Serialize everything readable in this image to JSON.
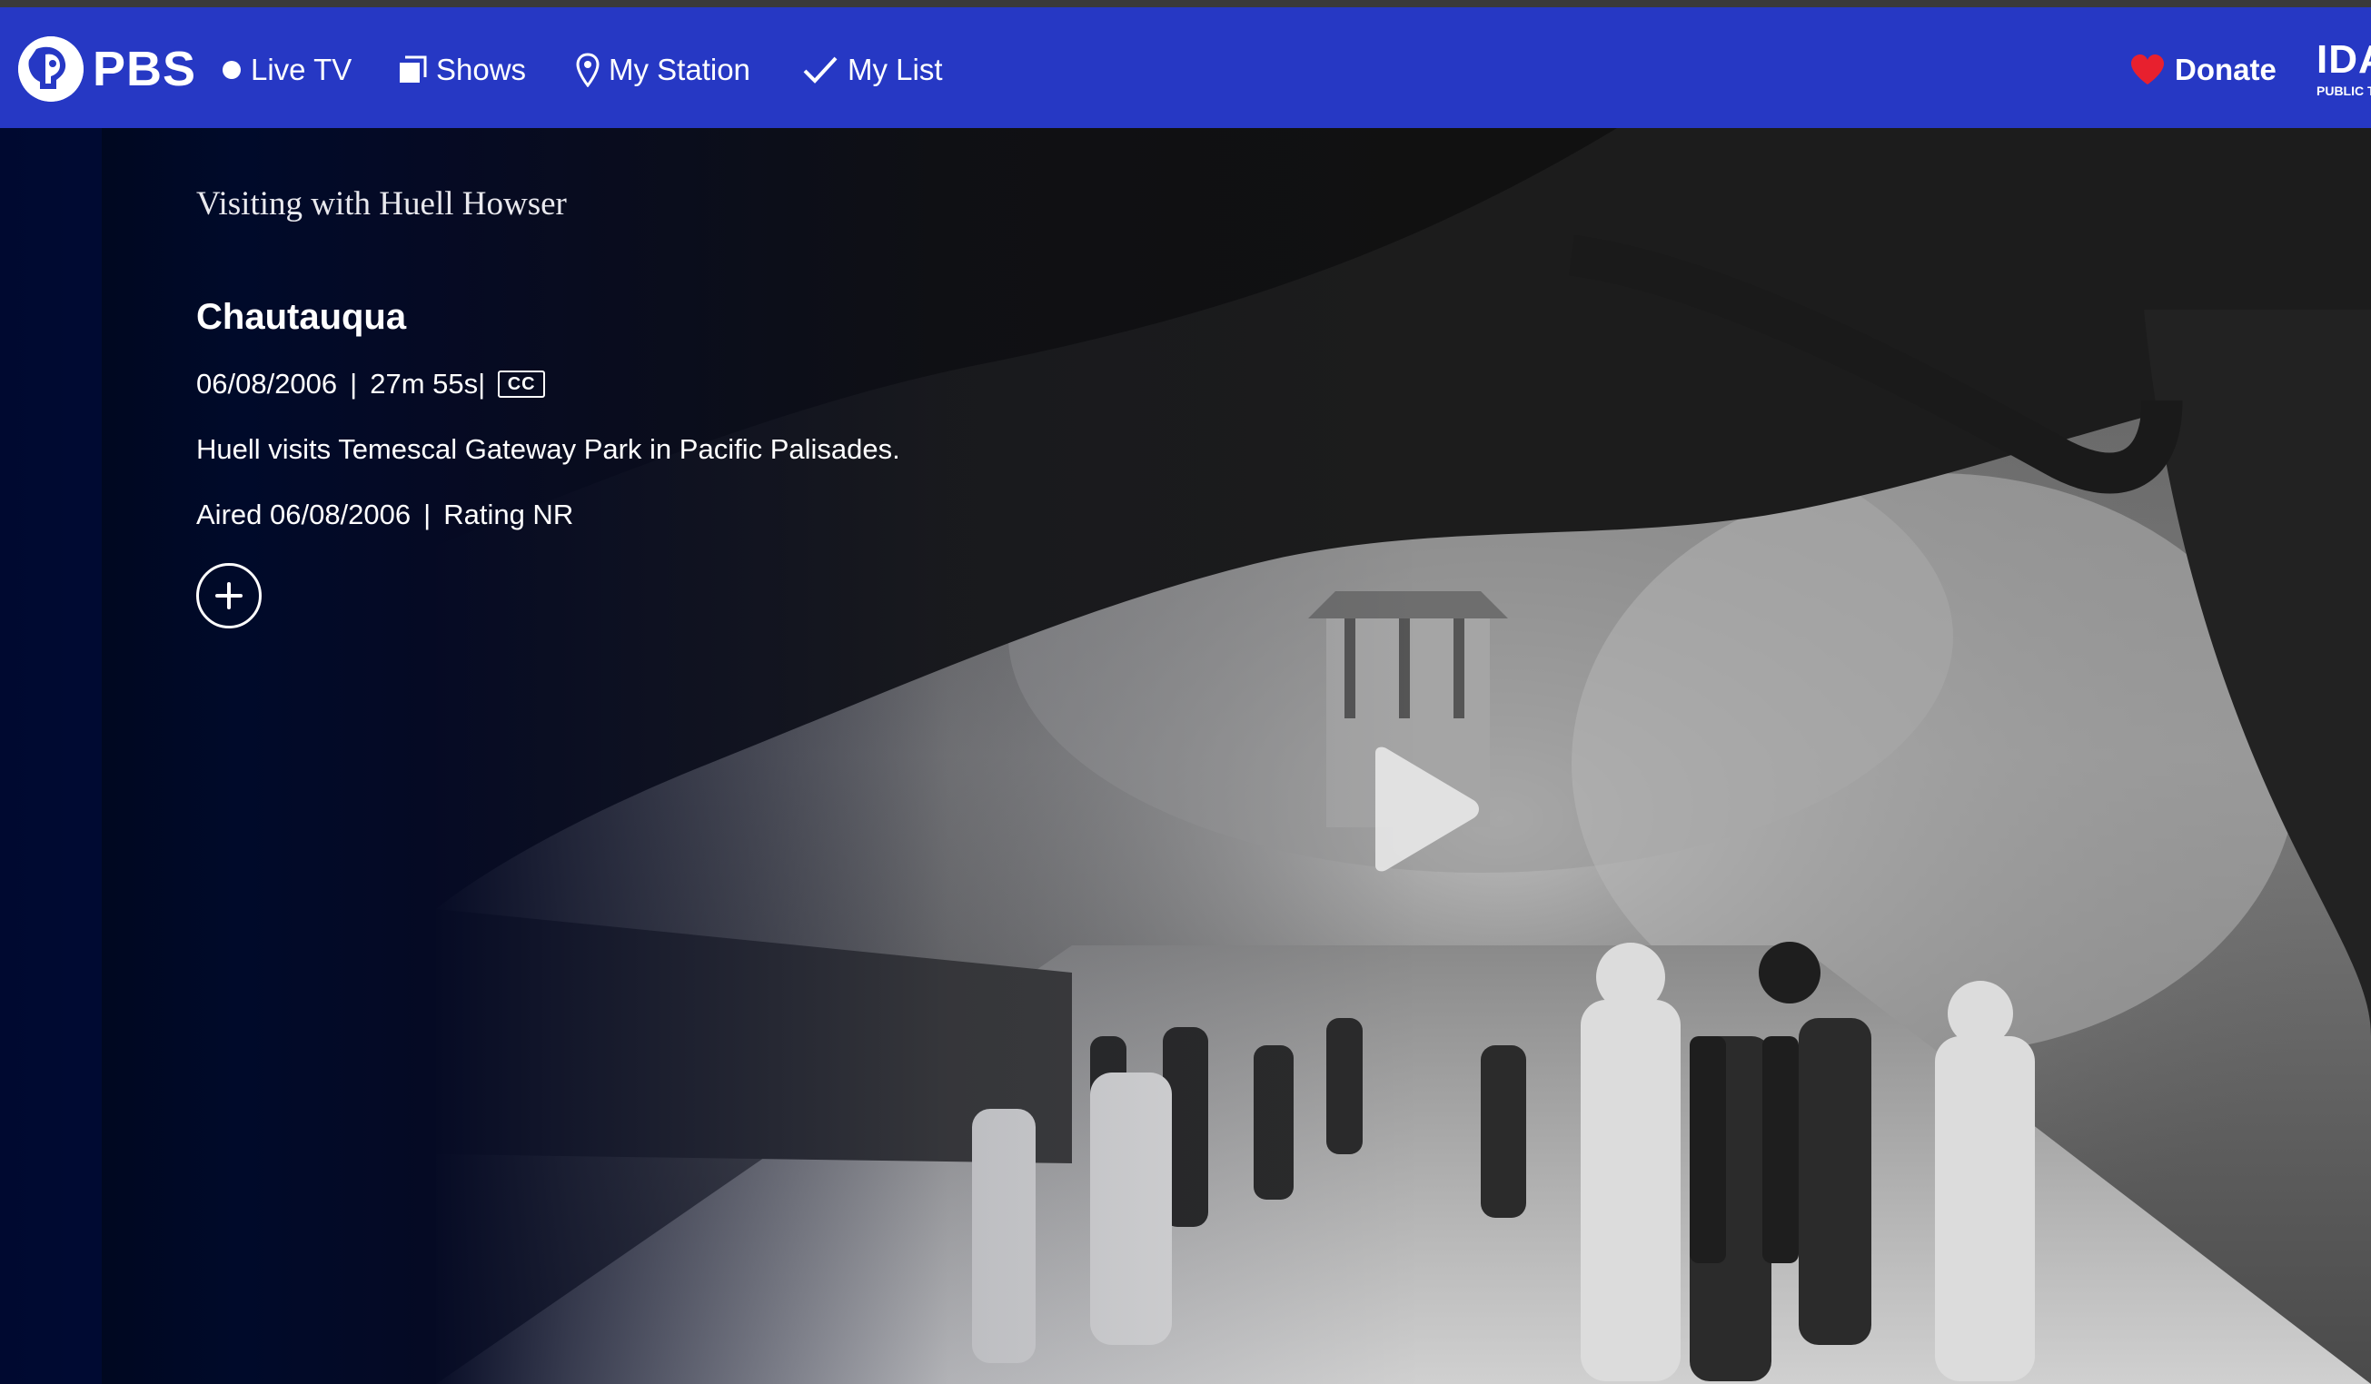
{
  "brand": {
    "name": "PBS",
    "icon": "pbs-head-logo"
  },
  "nav": {
    "items": [
      {
        "label": "Live TV",
        "icon": "dot-icon"
      },
      {
        "label": "Shows",
        "icon": "shows-icon"
      },
      {
        "label": "My Station",
        "icon": "location-pin-icon"
      },
      {
        "label": "My List",
        "icon": "check-icon"
      }
    ],
    "donate": {
      "label": "Donate",
      "icon": "heart-icon",
      "icon_color": "#e8202e"
    },
    "station": {
      "name": "IDA",
      "tagline": "PUBLIC T"
    }
  },
  "episode": {
    "series": "Visiting with Huell Howser",
    "title": "Chautauqua",
    "date": "06/08/2006",
    "duration": "27m 55s",
    "separator": "|",
    "cc_label": "CC",
    "description": "Huell visits Temescal Gateway Park in Pacific Palisades.",
    "aired": "Aired 06/08/2006",
    "rating": "Rating NR"
  },
  "video": {
    "play_icon": "play-icon",
    "add_icon": "plus-icon"
  },
  "colors": {
    "nav_bg": "#2638c4",
    "page_bg": "#0a0f2e",
    "heart": "#e8202e"
  }
}
